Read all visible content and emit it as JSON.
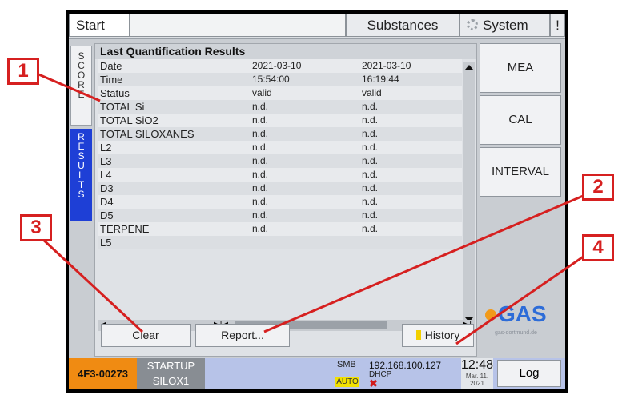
{
  "topbar": {
    "start": "Start",
    "substances": "Substances",
    "system": "System",
    "bang": "!"
  },
  "left_tabs": {
    "score": [
      "S",
      "C",
      "O",
      "R",
      "E"
    ],
    "results": [
      "R",
      "E",
      "S",
      "U",
      "L",
      "T",
      "S"
    ]
  },
  "panel": {
    "title": "Last Quantification Results",
    "rows": [
      [
        "Date",
        "2021-03-10",
        "2021-03-10"
      ],
      [
        "Time",
        "15:54:00",
        "16:19:44"
      ],
      [
        "Status",
        "valid",
        "valid"
      ],
      [
        "TOTAL Si",
        "n.d.",
        "n.d."
      ],
      [
        "TOTAL SiO2",
        "n.d.",
        "n.d."
      ],
      [
        "TOTAL SILOXANES",
        "n.d.",
        "n.d."
      ],
      [
        "L2",
        "n.d.",
        "n.d."
      ],
      [
        "L3",
        "n.d.",
        "n.d."
      ],
      [
        "L4",
        "n.d.",
        "n.d."
      ],
      [
        "D3",
        "n.d.",
        "n.d."
      ],
      [
        "D4",
        "n.d.",
        "n.d."
      ],
      [
        "D5",
        "n.d.",
        "n.d."
      ],
      [
        "TERPENE",
        "n.d.",
        "n.d."
      ],
      [
        "L5",
        "",
        ""
      ]
    ]
  },
  "buttons": {
    "clear": "Clear",
    "report": "Report...",
    "history": "History"
  },
  "side": {
    "mea": "MEA",
    "cal": "CAL",
    "interval": "INTERVAL"
  },
  "logo": {
    "text": "GAS",
    "sub": "gas-dortmund.de"
  },
  "status": {
    "id": "4F3-00273",
    "mode1": "STARTUP",
    "mode2": "SILOX1",
    "smb": "SMB",
    "auto": "AUTO",
    "ip": "192.168.100.127",
    "dhcp": "DHCP",
    "x": "✖",
    "time": "12:48",
    "date1": "Mar. 11.",
    "date2": "2021",
    "log": "Log"
  },
  "callouts": [
    "1",
    "2",
    "3",
    "4"
  ],
  "colors": {
    "callout": "#d62020",
    "results_tab": "#1e3fd6",
    "id_badge": "#f08b12"
  }
}
